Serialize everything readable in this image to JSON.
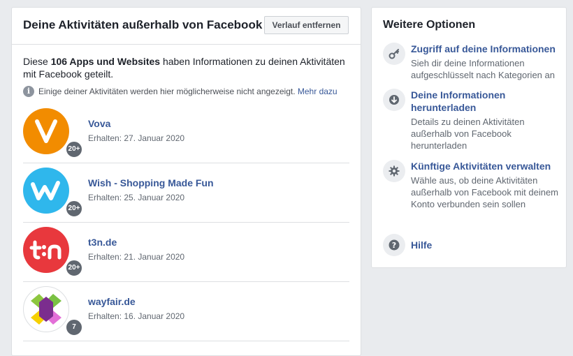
{
  "main": {
    "title": "Deine Aktivitäten außerhalb von Facebook",
    "clear_button": "Verlauf entfernen",
    "intro_prefix": "Diese ",
    "intro_bold": "106 Apps und Websites",
    "intro_suffix": " haben Informationen zu deinen Aktivitäten mit Facebook geteilt.",
    "note_text": "Einige deiner Aktivitäten werden hier möglicherweise nicht angezeigt.",
    "note_link": "Mehr dazu",
    "apps": [
      {
        "name": "Vova",
        "date": "Erhalten: 27. Januar 2020",
        "badge": "20+",
        "logo_text": "V",
        "logo_color": "#f28c00"
      },
      {
        "name": "Wish - Shopping Made Fun",
        "date": "Erhalten: 25. Januar 2020",
        "badge": "20+",
        "logo_text": "w",
        "logo_color": "#2fb7ec"
      },
      {
        "name": "t3n.de",
        "date": "Erhalten: 21. Januar 2020",
        "badge": "20+",
        "logo_text": "t:n",
        "logo_color": "#e8383d"
      },
      {
        "name": "wayfair.de",
        "date": "Erhalten: 16. Januar 2020",
        "badge": "7",
        "logo_text": "",
        "logo_color": "#ffffff"
      }
    ]
  },
  "side": {
    "title": "Weitere Optionen",
    "options": [
      {
        "title": "Zugriff auf deine Informationen",
        "desc": "Sieh dir deine Informationen aufgeschlüsselt nach Kategorien an",
        "icon": "key-icon"
      },
      {
        "title": "Deine Informationen herunterladen",
        "desc": "Details zu deinen Aktivitäten außerhalb von Facebook herunterladen",
        "icon": "download-icon"
      },
      {
        "title": "Künftige Aktivitäten verwalten",
        "desc": "Wähle aus, ob deine Aktivitäten außerhalb von Facebook mit deinem Konto verbunden sein sollen",
        "icon": "gear-icon"
      },
      {
        "title": "Hilfe",
        "desc": "",
        "icon": "help-icon"
      }
    ]
  }
}
